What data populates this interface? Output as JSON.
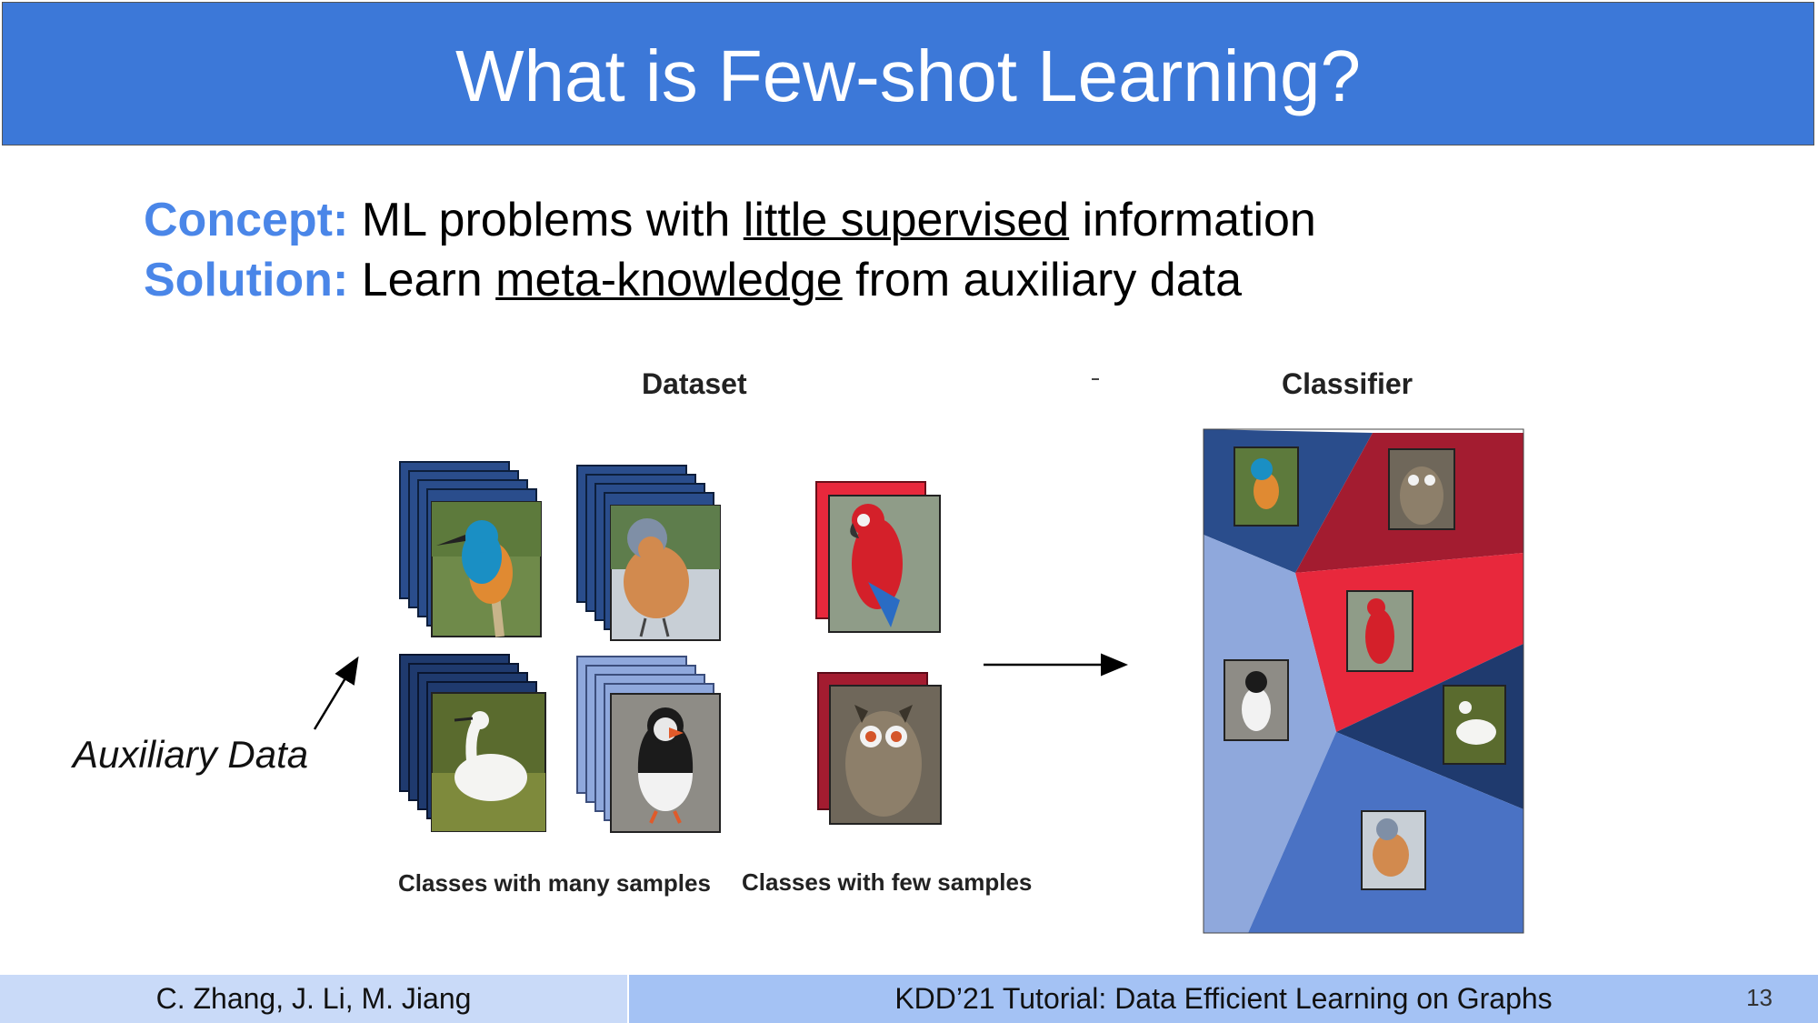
{
  "slide": {
    "title": "What is Few-shot Learning?",
    "concept": {
      "key": "Concept:",
      "text_before": " ML problems with ",
      "underlined": "little supervised",
      "text_after": " information"
    },
    "solution": {
      "key": "Solution:",
      "text_before": " Learn ",
      "underlined": "meta-knowledge",
      "text_after": " from auxiliary data"
    }
  },
  "figure": {
    "dataset_label": "Dataset",
    "classifier_label": "Classifier",
    "many_samples_caption": "Classes with many samples",
    "few_samples_caption": "Classes with few samples",
    "auxiliary_label": "Auxiliary Data",
    "birds": [
      "kingfisher",
      "chaffinch",
      "egret",
      "puffin",
      "macaw",
      "owl"
    ],
    "colors": {
      "dark_blue": "#2a4d8c",
      "navy": "#1f3a6e",
      "mid_blue": "#4a72c4",
      "light_blue": "#8fa8dc",
      "red": "#e8283c",
      "dark_red": "#a31c30"
    }
  },
  "footer": {
    "authors": "C. Zhang, J. Li, M. Jiang",
    "event": "KDD’21 Tutorial: Data Efficient Learning on Graphs",
    "page": "13"
  }
}
